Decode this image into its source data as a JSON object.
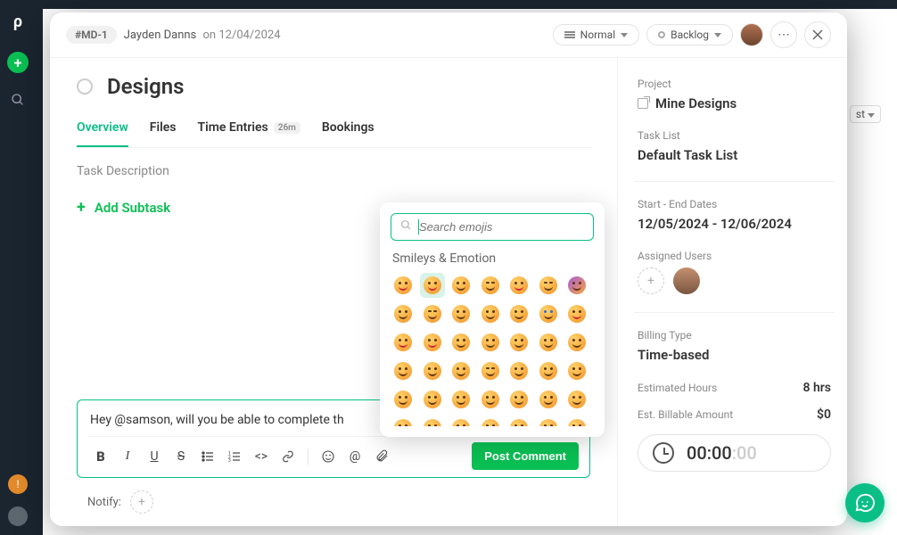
{
  "header": {
    "task_id": "#MD-1",
    "author": "Jayden Danns",
    "date_prefix": "on",
    "date": "12/04/2024",
    "priority_label": "Normal",
    "status_label": "Backlog"
  },
  "backdrop": {
    "dropdown": "st"
  },
  "task": {
    "title": "Designs",
    "description_label": "Task Description",
    "add_subtask_label": "Add Subtask"
  },
  "tabs": {
    "overview": "Overview",
    "files": "Files",
    "time_entries": "Time Entries",
    "time_entries_badge": "26m",
    "bookings": "Bookings"
  },
  "comment": {
    "text": "Hey @samson, will you be able to complete th",
    "post_label": "Post Comment"
  },
  "notify": {
    "label": "Notify:"
  },
  "emoji": {
    "search_placeholder": "Search emojis",
    "category": "Smileys & Emotion"
  },
  "sidebar": {
    "project_label": "Project",
    "project_value": "Mine Designs",
    "tasklist_label": "Task List",
    "tasklist_value": "Default Task List",
    "dates_label": "Start - End Dates",
    "dates_value": "12/05/2024 - 12/06/2024",
    "assigned_label": "Assigned Users",
    "billing_type_label": "Billing Type",
    "billing_type_value": "Time-based",
    "est_hours_label": "Estimated Hours",
    "est_hours_value": "8 hrs",
    "est_billable_label": "Est. Billable Amount",
    "est_billable_value": "$0",
    "timer_main": "00:00",
    "timer_faded": ":00"
  }
}
